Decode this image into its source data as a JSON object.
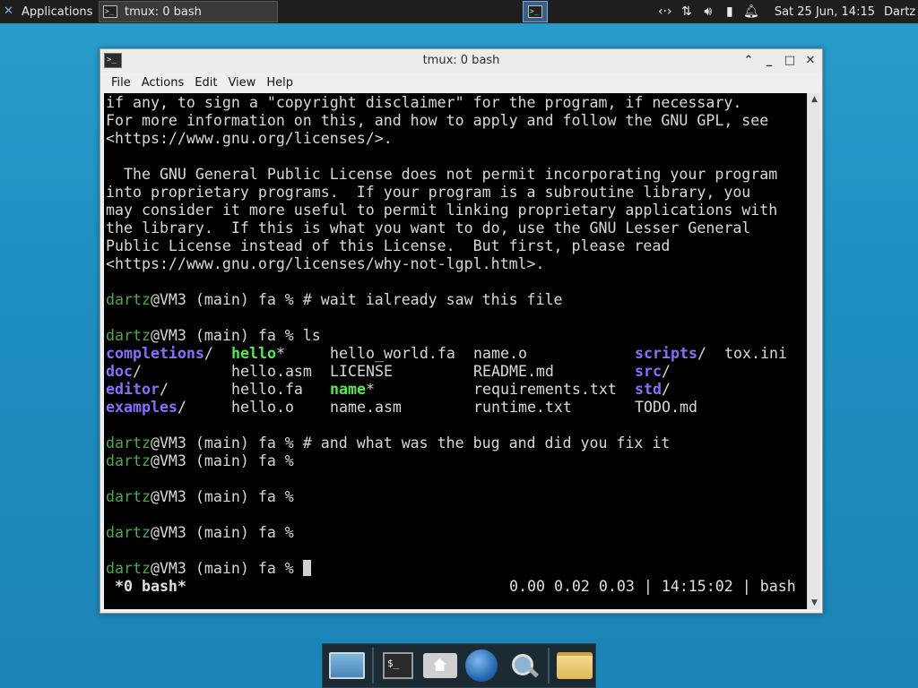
{
  "panel": {
    "apps_label": "Applications",
    "task_label": "tmux: 0 bash",
    "clock": "Sat 25 Jun, 14:15",
    "user": "Dartz"
  },
  "window": {
    "title": "tmux: 0 bash",
    "menu": [
      "File",
      "Actions",
      "Edit",
      "View",
      "Help"
    ]
  },
  "terminal": {
    "prompt_user": "dartz",
    "prompt_rest": "@VM3 (main) fa % ",
    "lines_top": [
      "if any, to sign a \"copyright disclaimer\" for the program, if necessary.",
      "For more information on this, and how to apply and follow the GNU GPL, see",
      "<https://www.gnu.org/licenses/>.",
      "",
      "  The GNU General Public License does not permit incorporating your program",
      "into proprietary programs.  If your program is a subroutine library, you",
      "may consider it more useful to permit linking proprietary applications with",
      "the library.  If this is what you want to do, use the GNU Lesser General",
      "Public License instead of this License.  But first, please read",
      "<https://www.gnu.org/licenses/why-not-lgpl.html>."
    ],
    "cmd1": "# wait ialready saw this file",
    "cmd2": "ls",
    "ls": {
      "col1": [
        {
          "name": "completions",
          "suffix": "/"
        },
        {
          "name": "doc",
          "suffix": "/"
        },
        {
          "name": "editor",
          "suffix": "/"
        },
        {
          "name": "examples",
          "suffix": "/"
        }
      ],
      "col2": [
        {
          "name": "hello",
          "suffix": "*"
        },
        {
          "name": "hello.asm",
          "suffix": ""
        },
        {
          "name": "hello.fa",
          "suffix": ""
        },
        {
          "name": "hello.o",
          "suffix": ""
        }
      ],
      "col3": [
        {
          "name": "hello_world.fa",
          "suffix": ""
        },
        {
          "name": "LICENSE",
          "suffix": ""
        },
        {
          "name": "name",
          "suffix": "*"
        },
        {
          "name": "name.asm",
          "suffix": ""
        }
      ],
      "col4": [
        {
          "name": "name.o",
          "suffix": ""
        },
        {
          "name": "README.md",
          "suffix": ""
        },
        {
          "name": "requirements.txt",
          "suffix": ""
        },
        {
          "name": "runtime.txt",
          "suffix": ""
        }
      ],
      "col5": [
        {
          "name": "scripts",
          "suffix": "/"
        },
        {
          "name": "src",
          "suffix": "/"
        },
        {
          "name": "std",
          "suffix": "/"
        },
        {
          "name": "TODO.md",
          "suffix": ""
        }
      ],
      "col6": [
        {
          "name": "tox.ini",
          "suffix": ""
        }
      ]
    },
    "cmd3": "# and what was the bug and did you fix it",
    "status_left": " *0 bash*",
    "status_right": "0.00 0.02 0.03 | 14:15:02 | bash"
  },
  "colors": {
    "prompt_green": "#4aa94c",
    "dir_purple": "#8b6cff",
    "exe_green": "#52ea52"
  }
}
